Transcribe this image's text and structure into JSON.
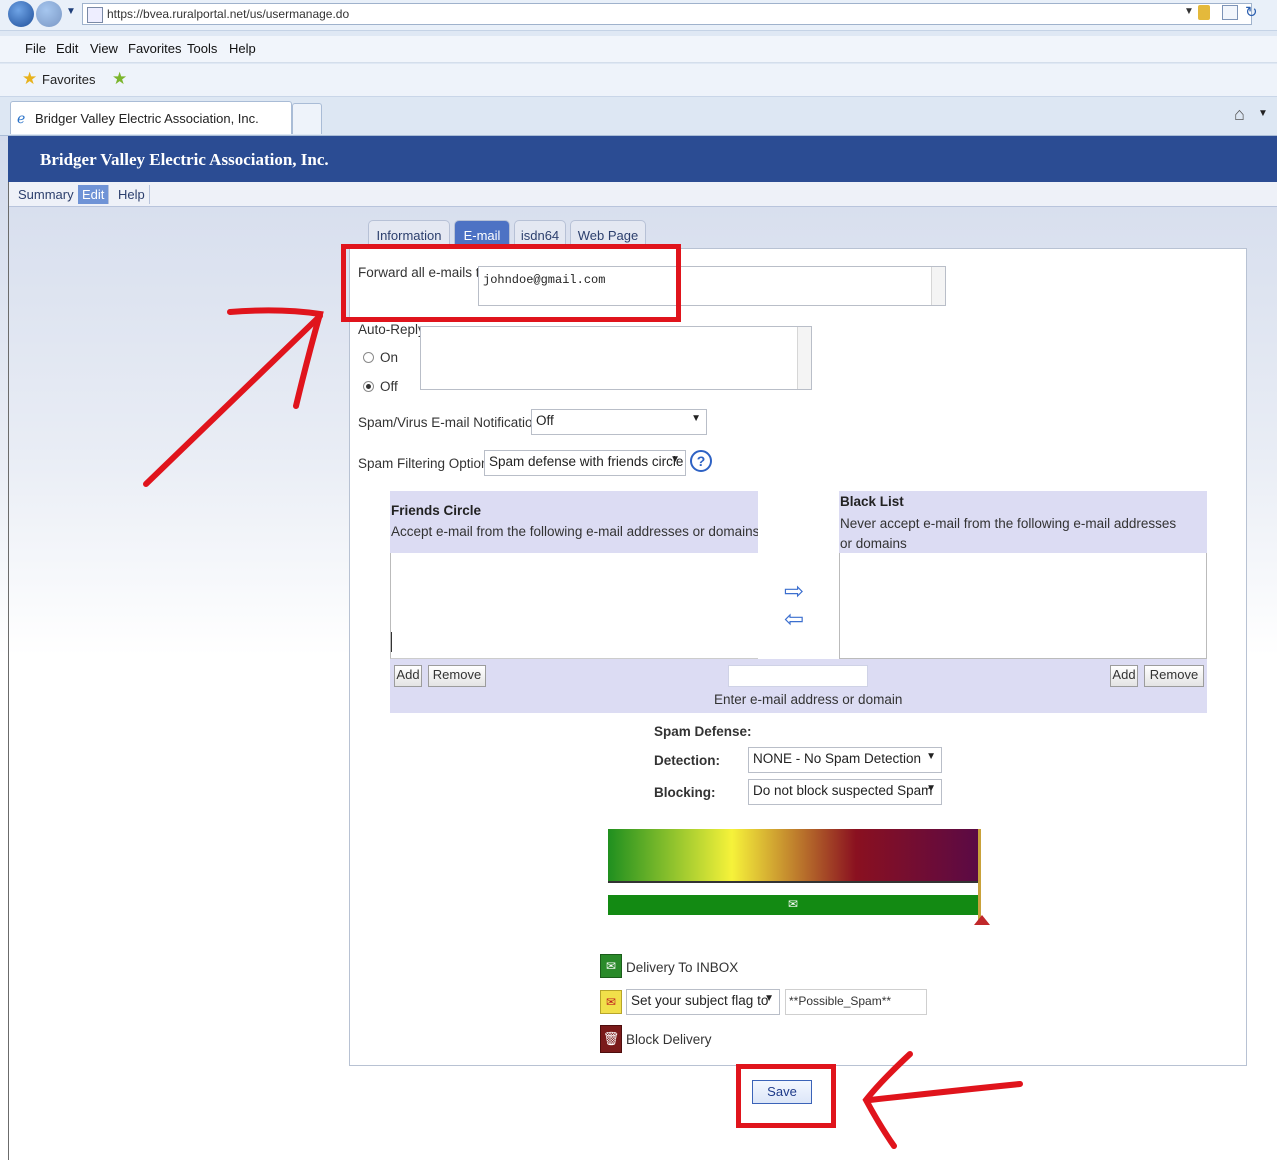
{
  "browser": {
    "url": "https://bvea.ruralportal.net/us/usermanage.do",
    "menu": [
      "File",
      "Edit",
      "View",
      "Favorites",
      "Tools",
      "Help"
    ],
    "favorites_label": "Favorites",
    "tab_title": "Bridger Valley Electric Association, Inc."
  },
  "site": {
    "title": "Bridger Valley Electric Association, Inc.",
    "nav": [
      "Summary",
      "Edit",
      "Help"
    ]
  },
  "tabs": [
    "Information",
    "E-mail",
    "isdn64",
    "Web Page"
  ],
  "form": {
    "forward_label": "Forward all e-mails to",
    "forward_value": "johndoe@gmail.com",
    "autoreply_label": "Auto-Reply",
    "autoreply_on": "On",
    "autoreply_off": "Off",
    "notifications_label": "Spam/Virus E-mail Notifications",
    "notifications_value": "Off",
    "filtering_label": "Spam Filtering Options",
    "filtering_value": "Spam defense with friends circle",
    "help_icon_text": "?"
  },
  "friends": {
    "title": "Friends Circle",
    "desc": "Accept e-mail from the following e-mail addresses or domains"
  },
  "blacklist": {
    "title": "Black List",
    "desc": "Never accept e-mail from the following e-mail addresses or domains"
  },
  "list_controls": {
    "add": "Add",
    "remove": "Remove",
    "input_hint": "Enter e-mail address or domain"
  },
  "spam_defense": {
    "heading": "Spam Defense:",
    "detection_label": "Detection:",
    "detection_value": "NONE - No Spam Detection",
    "blocking_label": "Blocking:",
    "blocking_value": "Do not block suspected Spam"
  },
  "gauge": {
    "level": 1.0,
    "colors": [
      "#1f8f1f",
      "#f6f23a",
      "#8a1020",
      "#5a0a45"
    ]
  },
  "legend": {
    "inbox": "Delivery To INBOX",
    "subject_flag_select": "Set your subject flag to",
    "subject_flag_value": "**Possible_Spam**",
    "block": "Block Delivery"
  },
  "save_label": "Save"
}
